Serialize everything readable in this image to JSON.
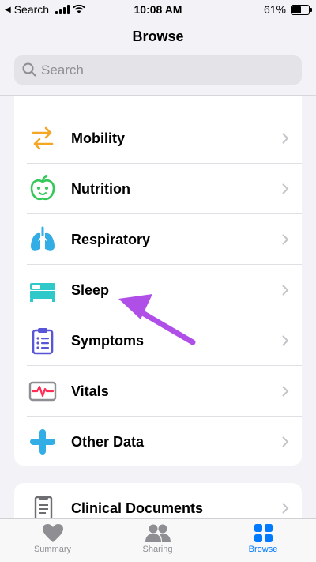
{
  "status_bar": {
    "back_label": "Search",
    "time": "10:08 AM",
    "battery_percent": "61%",
    "battery_level": 0.61
  },
  "nav": {
    "title": "Browse"
  },
  "search": {
    "placeholder": "Search"
  },
  "categories": [
    {
      "label": "Mobility",
      "icon": "mobility-arrows-icon",
      "color": "#f5a623"
    },
    {
      "label": "Nutrition",
      "icon": "apple-icon",
      "color": "#34c759"
    },
    {
      "label": "Respiratory",
      "icon": "lungs-icon",
      "color": "#32ade6"
    },
    {
      "label": "Sleep",
      "icon": "bed-icon",
      "color": "#30c9c9"
    },
    {
      "label": "Symptoms",
      "icon": "clipboard-icon",
      "color": "#5856d6"
    },
    {
      "label": "Vitals",
      "icon": "heartbeat-monitor-icon",
      "color": "#ff2d55"
    },
    {
      "label": "Other Data",
      "icon": "plus-icon",
      "color": "#32ade6"
    }
  ],
  "health_records": [
    {
      "label": "Clinical Documents",
      "icon": "document-icon",
      "color": "#8e8e93"
    }
  ],
  "tab_bar": {
    "tabs": [
      {
        "label": "Summary",
        "icon": "heart-icon",
        "selected": false
      },
      {
        "label": "Sharing",
        "icon": "people-icon",
        "selected": false
      },
      {
        "label": "Browse",
        "icon": "grid-icon",
        "selected": true
      }
    ],
    "active_color": "#007aff",
    "inactive_color": "#8e8e93"
  },
  "annotation": {
    "arrow_color": "#b04ee8",
    "points_to": "Sleep"
  }
}
